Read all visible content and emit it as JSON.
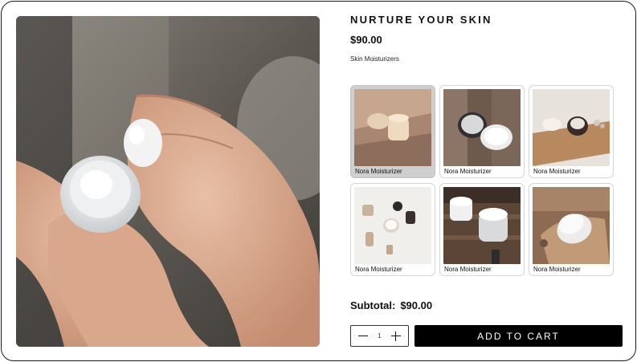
{
  "product": {
    "title": "NURTURE YOUR SKIN",
    "price": "$90.00",
    "category": "Skin Moisturizers",
    "hero_image": "hands-applying-cream-photo"
  },
  "variants": [
    {
      "label": "Nora Moisturizer",
      "image": "jar-on-beige-shelf-photo",
      "selected": true
    },
    {
      "label": "Nora Moisturizer",
      "image": "open-jars-on-wood-photo",
      "selected": false
    },
    {
      "label": "Nora Moisturizer",
      "image": "jar-on-cutting-board-photo",
      "selected": false
    },
    {
      "label": "Nora Moisturizer",
      "image": "jars-with-stones-photo",
      "selected": false
    },
    {
      "label": "Nora Moisturizer",
      "image": "open-jar-on-bench-photo",
      "selected": false
    },
    {
      "label": "Nora Moisturizer",
      "image": "tilted-jar-on-tray-photo",
      "selected": false
    }
  ],
  "subtotal": {
    "label": "Subtotal:",
    "value": "$90.00"
  },
  "quantity": {
    "value": "1",
    "decrement_icon": "minus-icon",
    "increment_icon": "plus-icon"
  },
  "cart": {
    "label": "ADD TO CART"
  }
}
